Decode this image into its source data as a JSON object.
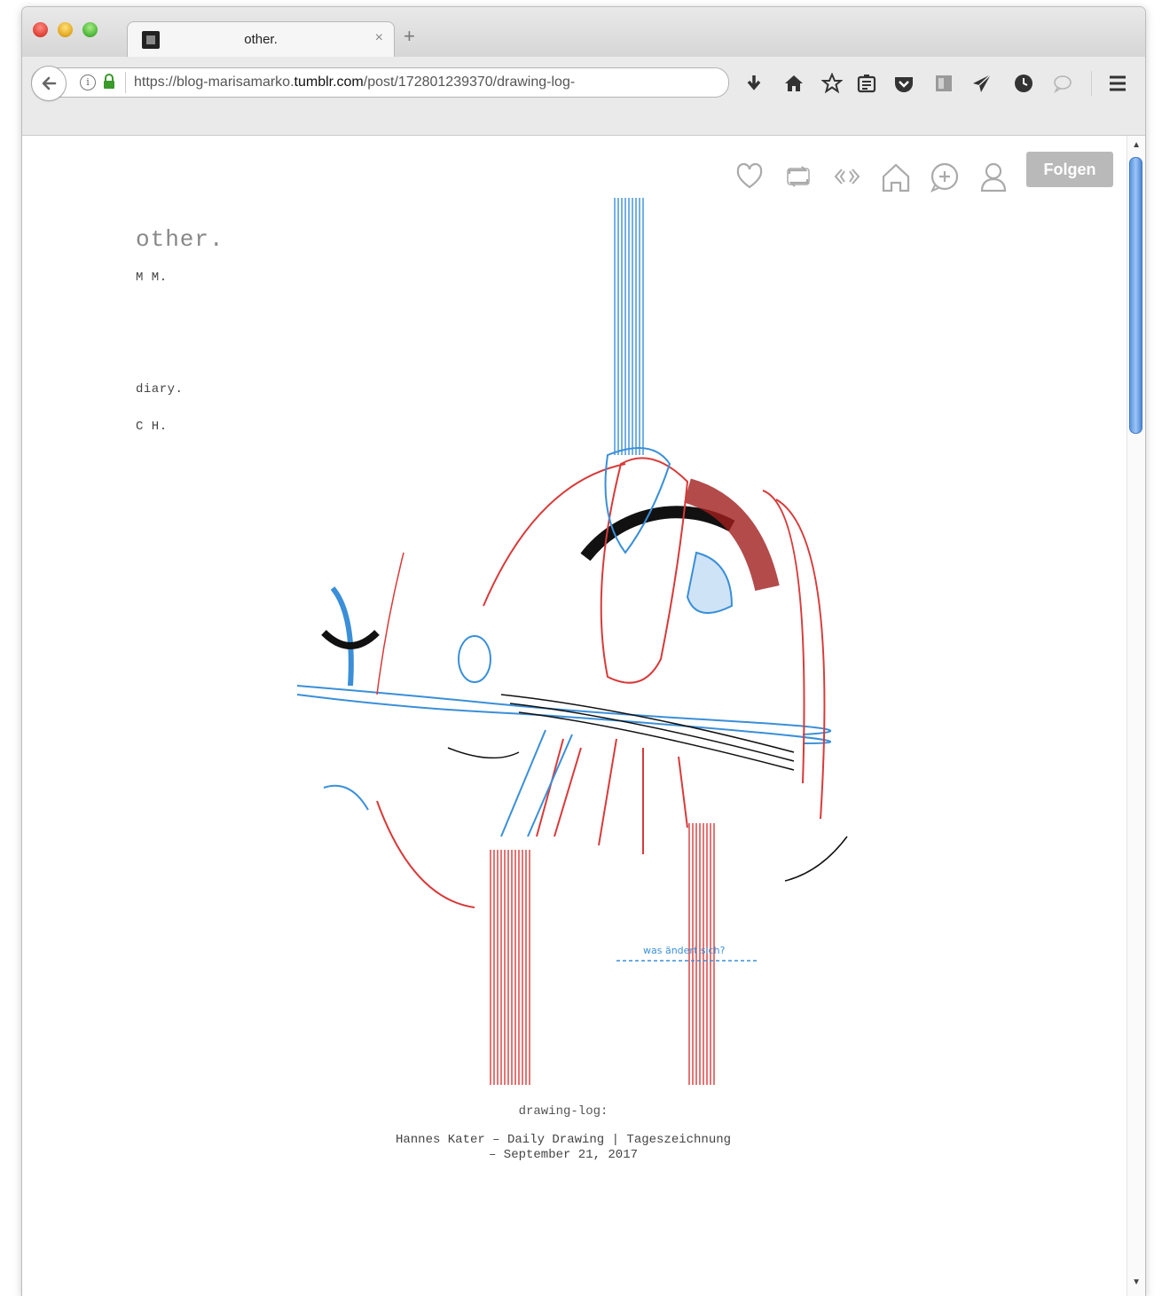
{
  "browser": {
    "tab_title": "other.",
    "tab_close": "×",
    "new_tab": "+",
    "url_prefix": "https://blog-marisamarko.",
    "url_domain": "tumblr.com",
    "url_path": "/post/172801239370/drawing-log-"
  },
  "toolbar": {
    "icons": [
      "download-icon",
      "home-icon",
      "star-icon",
      "reader-icon",
      "pocket-icon",
      "extension-icon",
      "send-icon",
      "history-icon",
      "chat-icon",
      "menu-icon"
    ]
  },
  "tumblr_controls": {
    "icons": [
      "heart-icon",
      "reblog-icon",
      "embed-icon",
      "dashboard-icon",
      "add-icon",
      "account-icon"
    ],
    "follow_label": "Folgen"
  },
  "blog": {
    "title": "other.",
    "subtitle": "M M.",
    "nav_diary": "diary.",
    "nav_ch": "C H."
  },
  "post": {
    "drawing_text": "was ändert sich?",
    "caption_title": "drawing-log:",
    "caption_line1": "Hannes Kater – Daily Drawing | Tageszeichnung",
    "caption_line2": "– September 21, 2017"
  },
  "colors": {
    "blue": "#3a8fd8",
    "red": "#d83a3a",
    "follow_bg": "#b9b9b9"
  }
}
